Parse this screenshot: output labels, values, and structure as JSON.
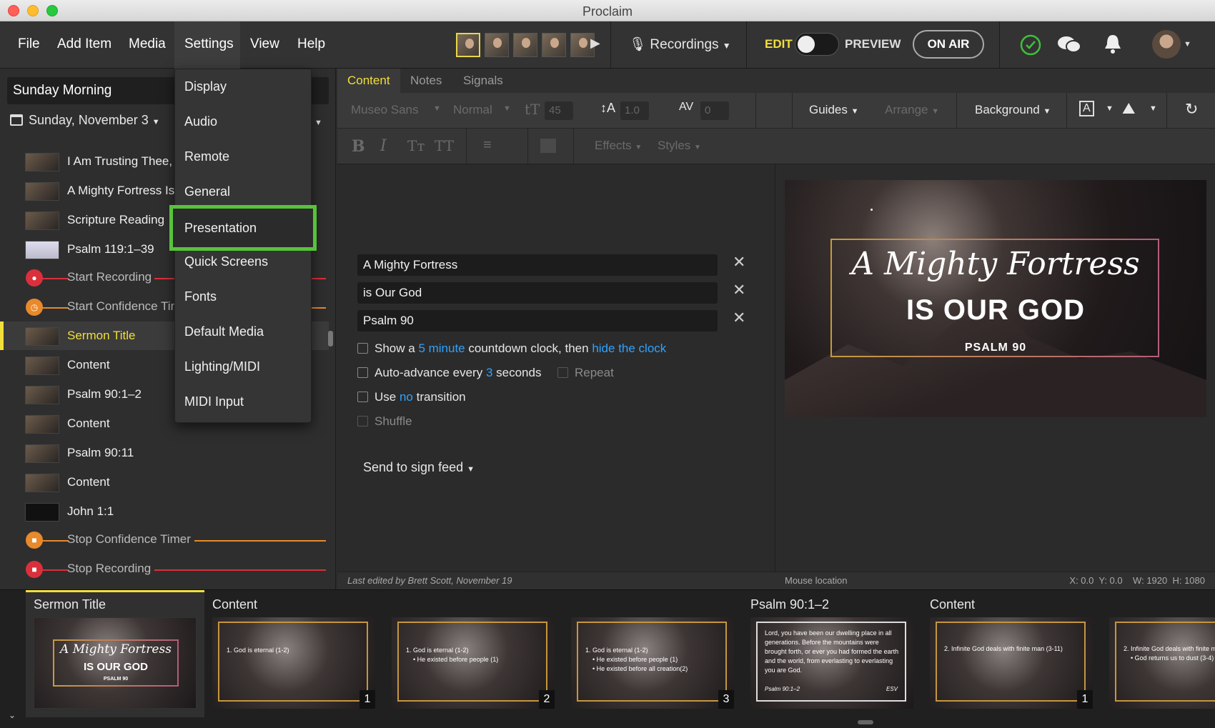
{
  "window": {
    "title": "Proclaim"
  },
  "menu": [
    "File",
    "Add Item",
    "Media",
    "Settings",
    "View",
    "Help"
  ],
  "toolbar": {
    "recordings": "Recordings",
    "edit": "EDIT",
    "preview": "PREVIEW",
    "on_air": "ON AIR"
  },
  "settings_menu": [
    "Display",
    "Audio",
    "Remote",
    "General",
    "Presentation",
    "Quick Screens",
    "Fonts",
    "Default Media",
    "Lighting/MIDI",
    "MIDI Input"
  ],
  "sidebar": {
    "service": "Sunday Morning",
    "date": "Sunday, November 3",
    "items": [
      "I Am Trusting Thee, Lord Jesus",
      "A Mighty Fortress Is Our God",
      "Scripture Reading",
      "Psalm 119:1–39",
      "Start Recording",
      "Start Confidence Timer",
      "Sermon Title",
      "Content",
      "Psalm 90:1–2",
      "Content",
      "Psalm 90:11",
      "Content",
      "John 1:1",
      "Stop Confidence Timer",
      "Stop Recording"
    ]
  },
  "tabs": [
    "Content",
    "Notes",
    "Signals"
  ],
  "format": {
    "font": "Museo Sans",
    "weight": "Normal",
    "size": "45",
    "line": "1.0",
    "spacing": "0",
    "guides": "Guides",
    "arrange": "Arrange",
    "background": "Background",
    "effects": "Effects",
    "styles": "Styles"
  },
  "content": {
    "line1": "A Mighty Fortress",
    "line2": "is Our God",
    "line3": "Psalm 90",
    "opt1_a": "Show a",
    "opt1_b": "5 minute",
    "opt1_c": "countdown clock, then",
    "opt1_d": "hide the clock",
    "opt2_a": "Auto-advance every",
    "opt2_b": "3",
    "opt2_c": "seconds",
    "repeat": "Repeat",
    "opt3_a": "Use",
    "opt3_b": "no",
    "opt3_c": "transition",
    "shuffle": "Shuffle",
    "sign_feed": "Send to sign feed"
  },
  "preview": {
    "script": "A Mighty Fortress",
    "big": "IS OUR GOD",
    "small": "PSALM 90"
  },
  "status": {
    "edited": "Last edited by Brett Scott, November 19",
    "mouse": "Mouse location",
    "coords": "X: 0.0  Y: 0.0    W: 1920  H: 1080"
  },
  "strip": {
    "h1": "Sermon Title",
    "h2": "Content",
    "h3": "Psalm 90:1–2",
    "h4": "Content",
    "s1a": "1. God is eternal (1-2)",
    "s2b": "•  He existed before people (1)",
    "s3c": "•  He existed before all creation(2)",
    "p1": "Lord, you have been our dwelling place in all",
    "p2": "generations. Before the mountains were",
    "p3": "brought forth, or ever you had formed the earth",
    "p4": "and the world, from everlasting to everlasting",
    "p5": "you are God.",
    "pref": "Psalm 90:1–2",
    "pver": "ESV",
    "c2a": "2. Infinite God deals with finite man (3-11)",
    "c2b": "•  God returns us to dust (3-4)",
    "n1": "1",
    "n2": "2",
    "n3": "3",
    "n4": "1"
  }
}
